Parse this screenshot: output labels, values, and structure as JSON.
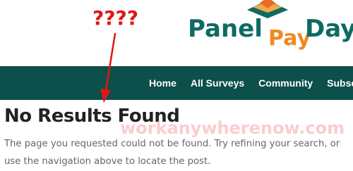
{
  "annotation": {
    "question_marks": "????",
    "color": "#e01616"
  },
  "logo": {
    "word_panel": "Panel",
    "word_pay": "Pay",
    "word_day": "Day",
    "color_primary": "#0e6b63",
    "color_accent": "#f08a1f"
  },
  "nav": {
    "background": "#0d4f4a",
    "items": [
      {
        "label": "Home"
      },
      {
        "label": "All Surveys"
      },
      {
        "label": "Community"
      },
      {
        "label": "Subscr"
      }
    ]
  },
  "main": {
    "title": "No Results Found",
    "body": "The page you requested could not be found. Try refining your search, or use the navigation above to locate the post."
  },
  "watermark": {
    "text": "workanywherenow.com"
  }
}
